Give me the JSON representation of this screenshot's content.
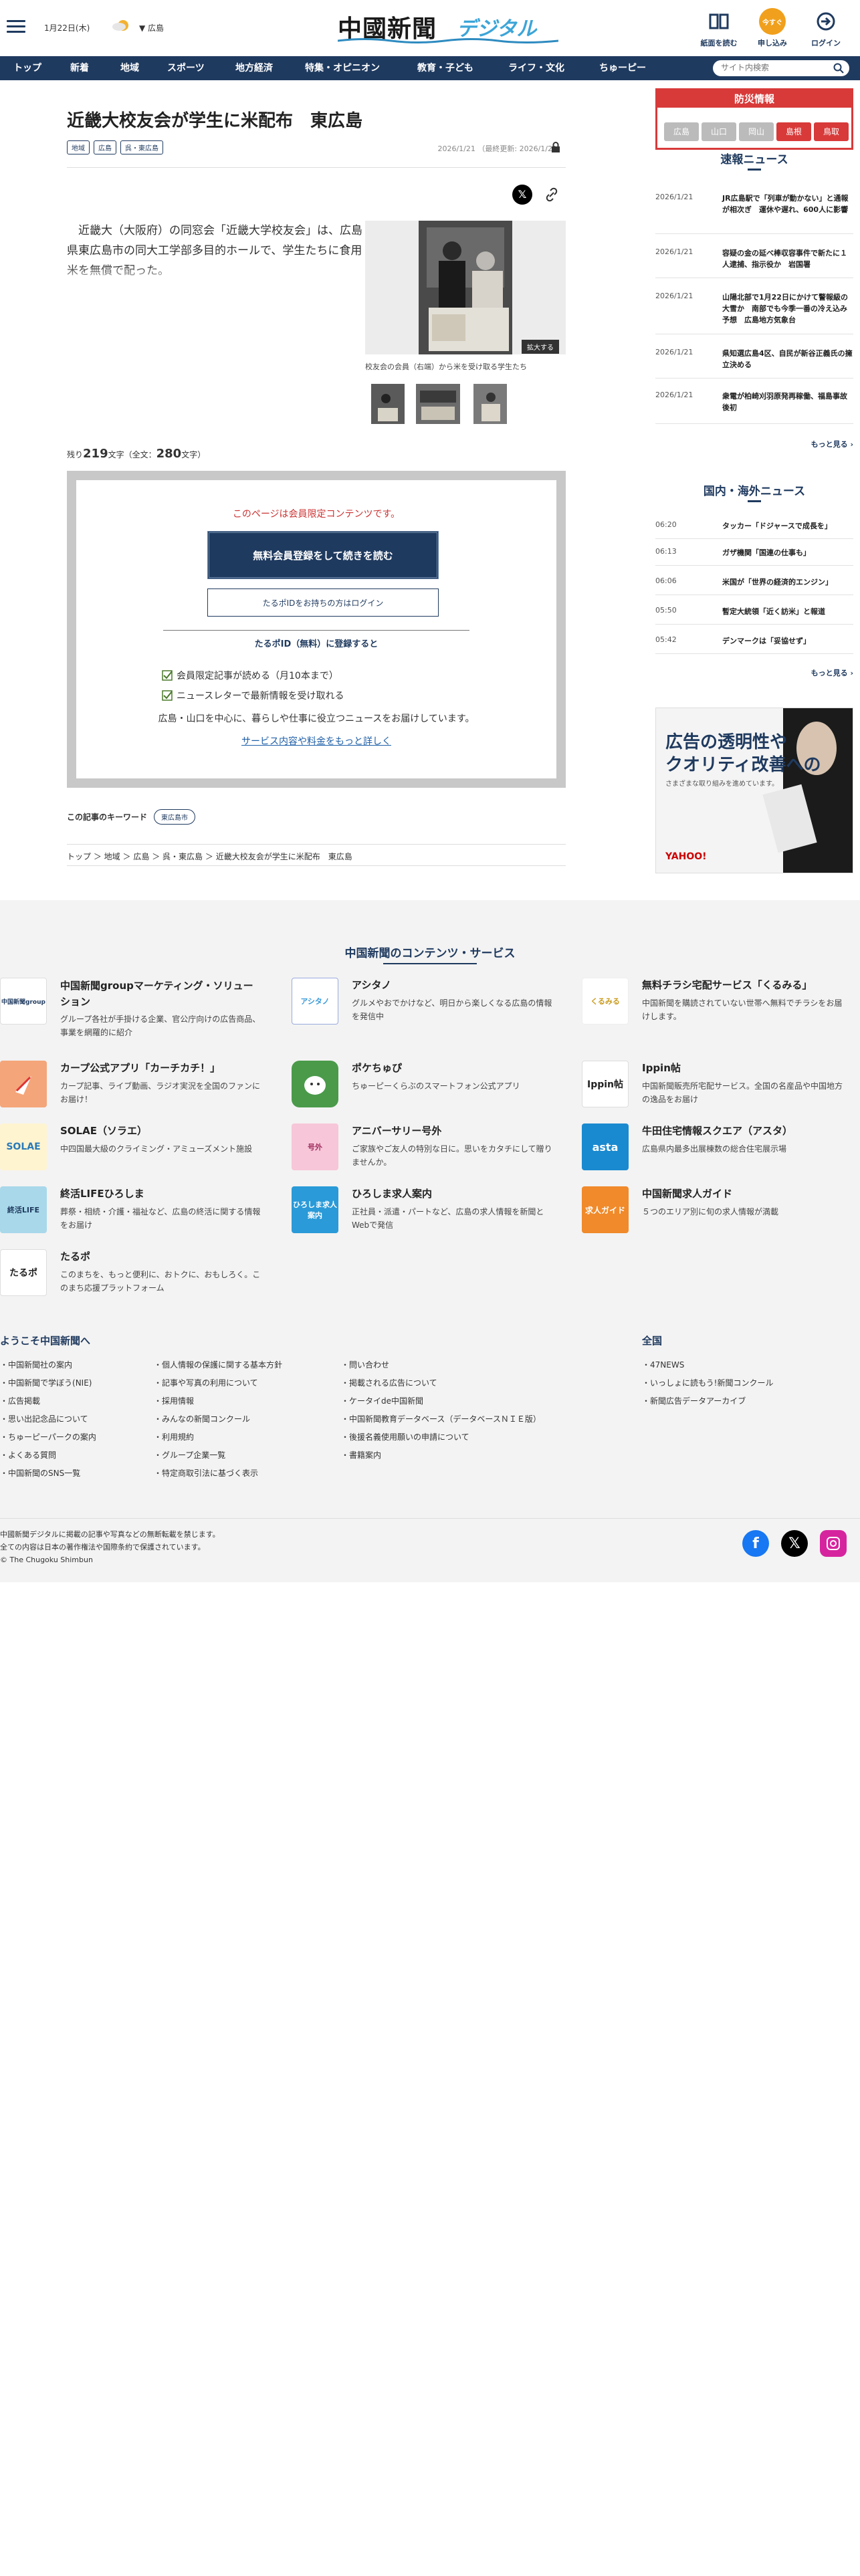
{
  "header": {
    "date": "1月22日(木)",
    "region": "広島",
    "logo_main": "中國新聞",
    "logo_sub": "デジタル",
    "icons": [
      {
        "label": "紙面を読む",
        "icon": "newspaper-icon"
      },
      {
        "label": "申し込み",
        "icon": "subscribe-icon",
        "badge": "今すぐ"
      },
      {
        "label": "ログイン",
        "icon": "login-icon"
      }
    ]
  },
  "nav": {
    "items": [
      "トップ",
      "新着",
      "地域",
      "スポーツ",
      "地方経済",
      "特集・オピニオン",
      "教育・子ども",
      "ライフ・文化",
      "ちゅーピー"
    ],
    "search_placeholder": "サイト内検索"
  },
  "article": {
    "title": "近畿大校友会が学生に米配布　東広島",
    "tags": [
      "地域",
      "広島",
      "呉・東広島"
    ],
    "date": "2026/1/21",
    "updated": "（最終更新: 2026/1/21）",
    "lead": "　近畿大（大阪府）の同窓会「近畿大学校友会」は、広島県東広島市の同大工学部多目的ホールで、学生たちに食用米を無償で配った。",
    "zoom_label": "拡大する",
    "caption": "校友会の会員（右端）から米を受け取る学生たち",
    "remain_prefix": "残り",
    "remain_count": "219",
    "remain_mid": "文字（全文：",
    "total_count": "280",
    "remain_suffix": "文字）"
  },
  "gate": {
    "message": "このページは会員限定コンテンツです。",
    "primary_button": "無料会員登録をして続きを読む",
    "secondary_button": "たるポIDをお持ちの方はログイン",
    "heading": "たるポID（無料）に登録すると",
    "benefits": [
      "会員限定記事が読める（月10本まで）",
      "ニュースレターで最新情報を受け取れる"
    ],
    "description": "広島・山口を中心に、暮らしや仕事に役立つニュースをお届けしています。",
    "link": "サービス内容や料金をもっと詳しく"
  },
  "keywords": {
    "label": "この記事のキーワード",
    "items": [
      "東広島市"
    ]
  },
  "breadcrumb": [
    "トップ",
    "地域",
    "広島",
    "呉・東広島",
    "近畿大校友会が学生に米配布　東広島"
  ],
  "disaster": {
    "title": "防災情報",
    "prefs": [
      {
        "label": "広島",
        "color": "#bbbbbb"
      },
      {
        "label": "山口",
        "color": "#bbbbbb"
      },
      {
        "label": "岡山",
        "color": "#bbbbbb"
      },
      {
        "label": "島根",
        "color": "#d83a3a"
      },
      {
        "label": "鳥取",
        "color": "#d83a3a"
      }
    ]
  },
  "breaking": {
    "title": "速報ニュース",
    "items": [
      {
        "date": "2026/1/21",
        "text": "JR広島駅で「列車が動かない」と通報が相次ぎ　運休や遅れ、600人に影響"
      },
      {
        "date": "2026/1/21",
        "text": "容疑の金の延べ棒収容事件で新たに１人逮捕、指示役か　岩国署"
      },
      {
        "date": "2026/1/21",
        "text": "山陽北部で1月22日にかけて警報級の大雪か　南部でも今季一番の冷え込み予想　広島地方気象台"
      },
      {
        "date": "2026/1/21",
        "text": "県知選広島4区、自民が新谷正義氏の擁立決める"
      },
      {
        "date": "2026/1/21",
        "text": "衆電が柏崎刈羽原発再稼働、福島事故後初"
      }
    ],
    "more": "もっと見る"
  },
  "world": {
    "title": "国内・海外ニュース",
    "items": [
      {
        "date": "06:20",
        "text": "タッカー「ドジャースで成長を」"
      },
      {
        "date": "06:13",
        "text": "ガザ機関「国連の仕事も」"
      },
      {
        "date": "06:06",
        "text": "米国が「世界の経済的エンジン」"
      },
      {
        "date": "05:50",
        "text": "暫定大統領「近く訪米」と報道"
      },
      {
        "date": "05:42",
        "text": "デンマークは「妥協せず」"
      }
    ],
    "more": "もっと見る"
  },
  "ad": {
    "line1": "広告の透明性や",
    "line2": "クオリティ改善への",
    "line3": "さまざまな取り組みを進めています。",
    "brand": "YAHOO!"
  },
  "services": {
    "title": "中国新聞のコンテンツ・サービス",
    "items": [
      {
        "name": "中国新聞groupマーケティング・ソリューション",
        "desc": "グループ各社が手掛ける企業、官公庁向けの広告商品、事業を網羅的に紹介",
        "icon": "chugoku-group-icon",
        "icon_text": "中国新聞group"
      },
      {
        "name": "アシタノ",
        "desc": "グルメやおでかけなど、明日から楽しくなる広島の情報を発信中",
        "icon": "ashitano-icon",
        "icon_text": "アシタノ"
      },
      {
        "name": "無料チラシ宅配サービス「くるみる」",
        "desc": "中国新聞を購読されていない世帯へ無料でチラシをお届けします。",
        "icon": "kurumiru-icon",
        "icon_text": "くるみる"
      },
      {
        "name": "カープ公式アプリ「カーチカチ！」",
        "desc": "カープ記事、ライブ動画、ラジオ実況を全国のファンにお届け！",
        "icon": "carp-app-icon",
        "icon_text": ""
      },
      {
        "name": "ポケちゅぴ",
        "desc": "ちゅーピーくらぶのスマートフォン公式アプリ",
        "icon": "pokechupi-icon",
        "icon_text": ""
      },
      {
        "name": "Ippin帖",
        "desc": "中国新聞販売所宅配サービス。全国の名産品や中国地方の逸品をお届け",
        "icon": "ippin-icon",
        "icon_text": "Ippin帖"
      },
      {
        "name": "SOLAE（ソラエ）",
        "desc": "中四国最大級のクライミング・アミューズメント施設",
        "icon": "solae-icon",
        "icon_text": "SOLAE"
      },
      {
        "name": "アニバーサリー号外",
        "desc": "ご家族やご友人の特別な日に。思いをカタチにして贈りませんか。",
        "icon": "anniversary-icon",
        "icon_text": "号外"
      },
      {
        "name": "牛田住宅情報スクエア（アスタ）",
        "desc": "広島県内最多出展棟数の総合住宅展示場",
        "icon": "asta-icon",
        "icon_text": "asta"
      },
      {
        "name": "終活LIFEひろしま",
        "desc": "葬祭・相続・介護・福祉など、広島の終活に関する情報をお届け",
        "icon": "shukatsu-icon",
        "icon_text": "終活LIFE"
      },
      {
        "name": "ひろしま求人案内",
        "desc": "正社員・派遣・パートなど、広島の求人情報を新聞とWebで発信",
        "icon": "hiroshima-jobs-icon",
        "icon_text": "ひろしま求人案内"
      },
      {
        "name": "中国新聞求人ガイド",
        "desc": "５つのエリア別に旬の求人情報が満載",
        "icon": "jobs-guide-icon",
        "icon_text": "求人ガイド"
      },
      {
        "name": "たるポ",
        "desc": "このまちを、もっと便利に、おトクに、おもしろく。このまち応援プラットフォーム",
        "icon": "tarupo-icon",
        "icon_text": "たるポ"
      }
    ]
  },
  "footer": {
    "welcome": "ようこそ中国新聞へ",
    "col1": [
      "中国新聞社の案内",
      "中国新聞で学ぼう(NIE)",
      "広告掲載",
      "思い出記念品について",
      "ちゅーピーパークの案内",
      "よくある質問",
      "中国新聞のSNS一覧"
    ],
    "col2": [
      "個人情報の保護に関する基本方針",
      "記事や写真の利用について",
      "採用情報",
      "みんなの新聞コンクール",
      "利用規約",
      "グループ企業一覧",
      "特定商取引法に基づく表示"
    ],
    "col3": [
      "問い合わせ",
      "掲載される広告について",
      "ケータイde中国新聞",
      "中国新聞教育データベース（データベースＮＩＥ版）",
      "後援名義使用願いの申請について",
      "書籍案内"
    ],
    "national_title": "全国",
    "national": [
      "47NEWS",
      "いっしょに読もう!新聞コンクール",
      "新聞広告データアーカイブ"
    ],
    "copy": [
      "中國新聞デジタルに掲載の記事や写真などの無断転載を禁じます。",
      "全ての内容は日本の著作権法や国際条約で保護されています。",
      "© The Chugoku Shimbun"
    ]
  }
}
